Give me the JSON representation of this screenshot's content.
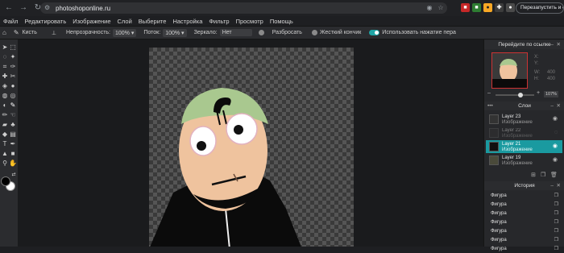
{
  "browser": {
    "url": "photoshoponline.ru",
    "restart_label": "Перезапустить и обн"
  },
  "menu": [
    "Файл",
    "Редактировать",
    "Изображение",
    "Слой",
    "Выберите",
    "Настройка",
    "Фильтр",
    "Просмотр",
    "Помощь"
  ],
  "options": {
    "brushes_label": "Кисть",
    "opacity_label": "Непрозрачность:",
    "opacity_value": "100% ▾",
    "flow_label": "Поток:",
    "flow_value": "100% ▾",
    "mirror_label": "Зеркало:",
    "mirror_value": "Нет",
    "scatter_label": "Разбросать",
    "hard_tip_label": "Жесткий кончик",
    "use_pressure_label": "Использовать нажатие пера"
  },
  "navigator": {
    "title": "Перейдите по ссылке",
    "x_label": "X:",
    "y_label": "Y:",
    "w_label": "W:",
    "w_value": "400",
    "h_label": "H:",
    "h_value": "400",
    "zoom_value": "107%"
  },
  "layers_panel": {
    "title": "Слои",
    "layers": [
      {
        "name": "Layer 23",
        "type": "Изображение"
      },
      {
        "name": "Layer 22",
        "type": "Изображение"
      },
      {
        "name": "Layer 21",
        "type": "Изображение"
      },
      {
        "name": "Layer 19",
        "type": "Изображение"
      }
    ]
  },
  "history_panel": {
    "title": "История",
    "items": [
      "Фигура",
      "Фигура",
      "Фигура",
      "Фигура",
      "Фигура",
      "Фигура",
      "Фигура"
    ]
  },
  "colors": {
    "accent": "#1ea5a5",
    "selected_layer": "#1a9aa0",
    "foreground": "#000000",
    "background": "#ffffff"
  }
}
